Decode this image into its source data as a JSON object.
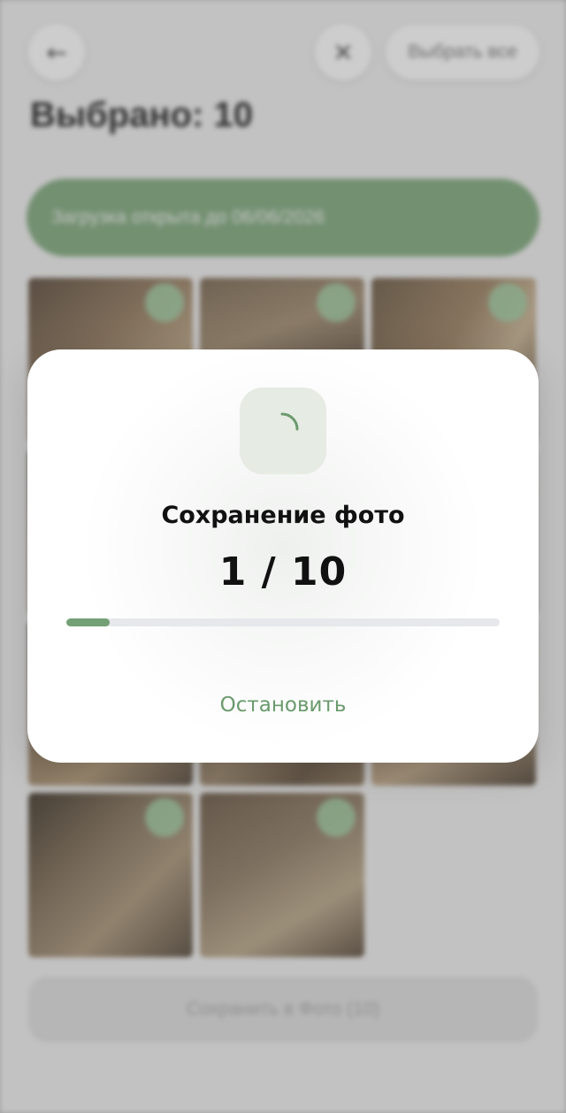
{
  "header": {
    "back_icon": "arrow-left-icon",
    "close_icon": "close-icon",
    "select_all_label": "Выбрать все"
  },
  "title": "Выбрано: 10",
  "banner_text": "Загрузка открыта до 06/06/2026",
  "photos": [
    {
      "selected": true
    },
    {
      "selected": true
    },
    {
      "selected": true
    },
    {
      "selected": true
    },
    {
      "selected": true
    },
    {
      "selected": true
    },
    {
      "selected": true
    },
    {
      "selected": true
    },
    {
      "selected": true
    },
    {
      "selected": true
    },
    {
      "selected": true
    }
  ],
  "bottom_button_label": "Сохранить в Фото (10)",
  "modal": {
    "title": "Сохранение фото",
    "counter": "1 / 10",
    "current": 1,
    "total": 10,
    "progress_fraction": 0.1,
    "stop_label": "Остановить",
    "spinner_icon": "spinner-icon"
  },
  "colors": {
    "accent_green": "#73a074",
    "banner_green": "#7fa87c",
    "stop_text": "#6a9a6c"
  }
}
